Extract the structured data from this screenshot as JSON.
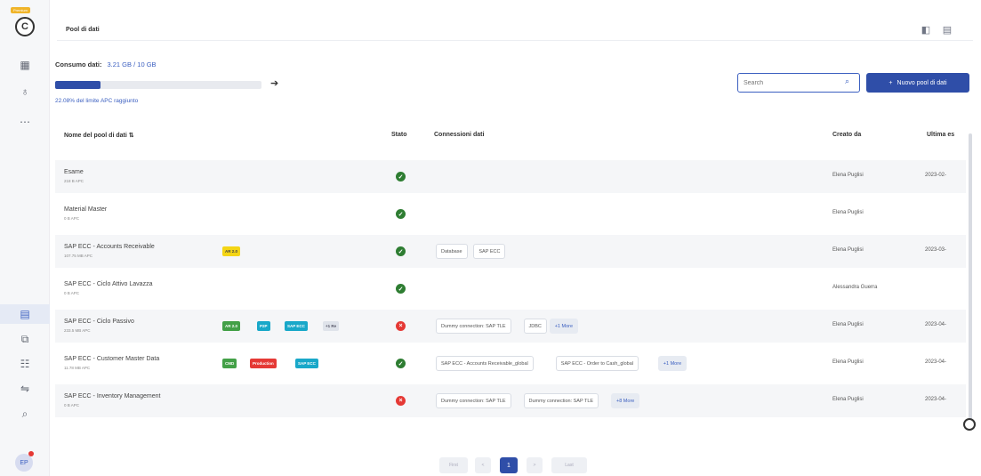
{
  "app": {
    "logo_letter": "C",
    "logo_tag": "Premium"
  },
  "header": {
    "breadcrumb": "Pool di dati"
  },
  "consumption": {
    "label": "Consumo dati:",
    "value": "3.21 GB / 10 GB",
    "progress_fraction": 0.22,
    "limit_text": "22.08% del limite APC raggiunto"
  },
  "search": {
    "placeholder": "Search"
  },
  "new_button": {
    "label": "Nuovo pool di dati",
    "icon": "plus-icon"
  },
  "table": {
    "columns": [
      "Nome del pool di dati",
      "Stato",
      "Connessioni dati",
      "Creato da",
      "Ultima es"
    ],
    "rows": [
      {
        "name": "Esame",
        "sub": "218 B APC",
        "tags": [],
        "status": "ok",
        "connections": [],
        "creator": "Elena Puglisi",
        "date": "2023-02-"
      },
      {
        "name": "Material Master",
        "sub": "0 B APC",
        "tags": [],
        "status": "ok",
        "connections": [],
        "creator": "Elena Puglisi",
        "date": ""
      },
      {
        "name": "SAP ECC - Accounts Receivable",
        "sub": "107.75 MB APC",
        "tags": [
          {
            "label": "AR 2.0",
            "color": "yellow"
          }
        ],
        "status": "ok",
        "connections": [
          {
            "label": "Database"
          },
          {
            "label": "SAP ECC"
          }
        ],
        "creator": "Elena Puglisi",
        "date": "2023-03-"
      },
      {
        "name": "SAP ECC - Ciclo Attivo Lavazza",
        "sub": "0 B APC",
        "tags": [],
        "status": "ok",
        "connections": [],
        "creator": "Alessandra Guerra",
        "date": ""
      },
      {
        "name": "SAP ECC - Ciclo Passivo",
        "sub": "233.5 MB APC",
        "tags": [
          {
            "label": "AR 2.0",
            "color": "green"
          },
          {
            "label": "P2P",
            "color": "teal"
          },
          {
            "label": "SAP ECC",
            "color": "teal"
          },
          {
            "label": "+1 Re",
            "color": "grey"
          }
        ],
        "status": "err",
        "connections": [
          {
            "label": "Dummy connection: SAP TLE"
          },
          {
            "label": "JDBC"
          },
          {
            "label": "+1 More",
            "more": true
          }
        ],
        "creator": "Elena Puglisi",
        "date": "2023-04-"
      },
      {
        "name": "SAP ECC - Customer Master Data",
        "sub": "11.78 MB APC",
        "tags": [
          {
            "label": "CMD",
            "color": "green"
          },
          {
            "label": "Production",
            "color": "red"
          },
          {
            "label": "SAP ECC",
            "color": "teal"
          }
        ],
        "status": "ok",
        "connections": [
          {
            "label": "SAP ECC - Accounts Receivable_global"
          },
          {
            "label": "SAP ECC - Order to Cash_global"
          },
          {
            "label": "+1 More",
            "more": true
          }
        ],
        "creator": "Elena Puglisi",
        "date": "2023-04-"
      },
      {
        "name": "SAP ECC - Inventory Management",
        "sub": "0 B APC",
        "tags": [],
        "status": "err",
        "connections": [
          {
            "label": "Dummy connection: SAP TLE"
          },
          {
            "label": "Dummy connection: SAP TLE"
          },
          {
            "label": "+8 More",
            "more": true
          }
        ],
        "creator": "Elena Puglisi",
        "date": "2023-04-"
      }
    ]
  },
  "pagination": {
    "first": "First",
    "prev": "<",
    "current": "1",
    "next": ">",
    "last": "Last"
  },
  "colors": {
    "accent": "#2f4ea8",
    "ok": "#2e7d32",
    "error": "#e53935"
  }
}
